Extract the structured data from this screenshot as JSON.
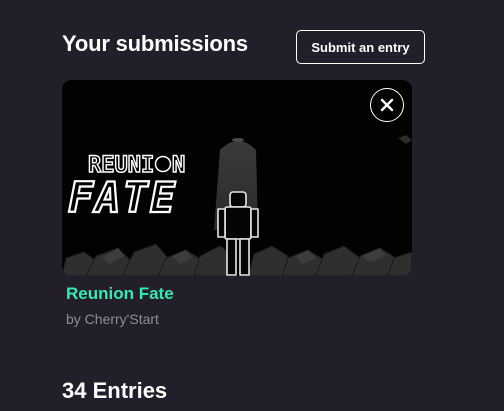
{
  "submissions": {
    "heading": "Your submissions",
    "submit_button_label": "Submit an entry"
  },
  "entry": {
    "title": "Reunion Fate",
    "byline": "by Cherry'Start",
    "thumbnail_logo_line1": "REUNI",
    "thumbnail_logo_line2": "N",
    "thumbnail_logo_line3": "FATE",
    "close_icon": "close-icon"
  },
  "entries": {
    "heading": "34 Entries"
  },
  "colors": {
    "background": "#221f2b",
    "accent": "#34e8b1",
    "muted_text": "#8e8c95"
  }
}
